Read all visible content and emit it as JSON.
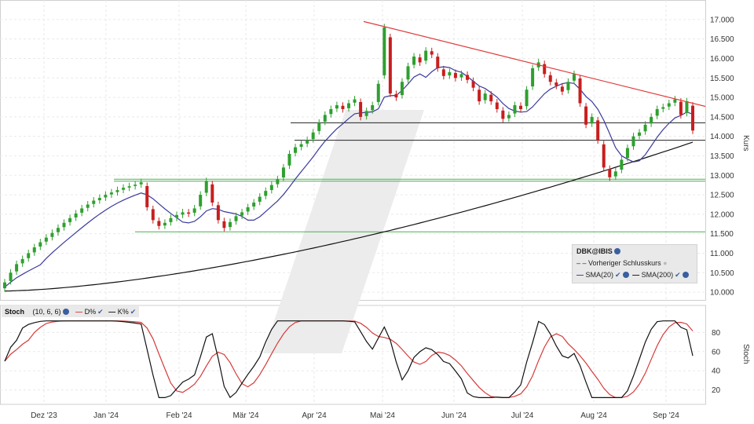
{
  "chart_data": [
    {
      "type": "candlestick",
      "symbol": "DBK@IBIS",
      "ylabel": "Kurs",
      "ylim": [
        9800,
        17300
      ],
      "y_ticks": [
        "17.000",
        "16.500",
        "16.000",
        "15.500",
        "15.000",
        "14.500",
        "14.000",
        "13.500",
        "13.000",
        "12.500",
        "12.000",
        "11.500",
        "11.000",
        "10.500",
        "10.000"
      ],
      "x_ticks": [
        "Dez '23",
        "Jan '24",
        "Feb '24",
        "Mär '24",
        "Apr '24",
        "Mai '24",
        "Jun '24",
        "Jul '24",
        "Aug '24",
        "Sep '24"
      ],
      "price_close": [
        10250,
        10500,
        10720,
        10850,
        11000,
        11150,
        11280,
        11400,
        11520,
        11650,
        11780,
        11900,
        12020,
        12150,
        12250,
        12350,
        12420,
        12500,
        12560,
        12620,
        12680,
        12720,
        12760,
        12820,
        12180,
        11850,
        11700,
        11780,
        11900,
        11980,
        12050,
        12020,
        12150,
        12500,
        12850,
        12300,
        11850,
        11650,
        11800,
        11950,
        12050,
        12180,
        12300,
        12450,
        12600,
        12750,
        12900,
        13200,
        13550,
        13720,
        13800,
        13900,
        14100,
        14350,
        14550,
        14700,
        14800,
        14700,
        14850,
        14950,
        14500,
        14650,
        14800,
        15350,
        16800,
        15100,
        15000,
        15400,
        15800,
        16050,
        15900,
        16200,
        16100,
        15750,
        15550,
        15650,
        15500,
        15600,
        15450,
        15250,
        14900,
        15100,
        14900,
        14700,
        14450,
        14550,
        14800,
        14700,
        15200,
        15750,
        15900,
        15600,
        15400,
        15300,
        15150,
        15400,
        15600,
        14850,
        14300,
        14500,
        13900,
        13200,
        12950,
        13100,
        13400,
        13700,
        14000,
        14100,
        14300,
        14500,
        14700,
        14750,
        14850,
        14950,
        14550,
        14900,
        14150
      ],
      "series": [
        {
          "name": "Vorheriger Schlusskurs",
          "type": "dashed"
        },
        {
          "name": "SMA(20)",
          "color": "#3a3a9c"
        },
        {
          "name": "SMA(200)",
          "color": "#111111"
        }
      ],
      "trendline": {
        "color": "#e03a3a",
        "from": [
          0.487,
          16950
        ],
        "to": [
          1.0,
          14770
        ]
      },
      "horizontal_levels_black": [
        14350,
        13900
      ],
      "horizontal_levels_green": [
        12900,
        12850,
        11550
      ],
      "legend_placement": "bottom-right"
    },
    {
      "type": "line",
      "title": "Stoch",
      "params": "(10, 6, 6)",
      "ylabel": "Stoch",
      "ylim": [
        5,
        95
      ],
      "y_ticks": [
        "80",
        "60",
        "40",
        "20"
      ],
      "series": [
        {
          "name": "D%",
          "color": "#d63a3a"
        },
        {
          "name": "K%",
          "color": "#111111"
        }
      ]
    }
  ],
  "legend": {
    "symbol": "DBK@IBIS",
    "prev_close": "Vorheriger Schlusskurs",
    "sma20": "SMA(20)",
    "sma200": "SMA(200)"
  },
  "stoch_header": {
    "title": "Stoch",
    "params": "(10, 6, 6)",
    "d_label": "D%",
    "k_label": "K%"
  },
  "colors": {
    "up": "#2ea02e",
    "down": "#c81e1e",
    "sma20": "#3a3a9c",
    "sma200": "#111111",
    "trend": "#e03a3a",
    "support_green": "#4caf50",
    "d": "#d63a3a",
    "k": "#111111"
  }
}
